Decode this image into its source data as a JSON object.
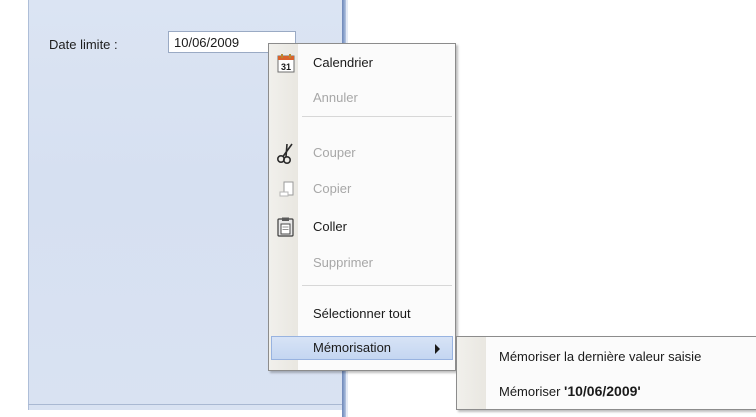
{
  "form": {
    "date_label": "Date limite :",
    "date_value": "10/06/2009"
  },
  "context_menu": {
    "items": [
      {
        "label": "Calendrier",
        "icon": "calendar-icon",
        "icon_text": "31",
        "enabled": true
      },
      {
        "label": "Annuler",
        "enabled": false
      },
      {
        "label": "Couper",
        "icon": "scissors-icon",
        "enabled": false
      },
      {
        "label": "Copier",
        "icon": "copy-icon",
        "enabled": false
      },
      {
        "label": "Coller",
        "icon": "clipboard-icon",
        "enabled": true
      },
      {
        "label": "Supprimer",
        "enabled": false
      },
      {
        "label": "Sélectionner tout",
        "enabled": true
      },
      {
        "label": "Mémorisation",
        "enabled": true,
        "highlighted": true,
        "has_submenu": true
      }
    ]
  },
  "submenu": {
    "item_last_value": "Mémoriser la dernière valeur saisie",
    "item_memorize_prefix": "Mémoriser ",
    "item_memorize_value": "'10/06/2009'"
  },
  "colors": {
    "panel_bg": "#d8e1f2",
    "highlight_bg": "#c9daf3",
    "highlight_border": "#98b3e0",
    "disabled_text": "#a7a7a7"
  }
}
